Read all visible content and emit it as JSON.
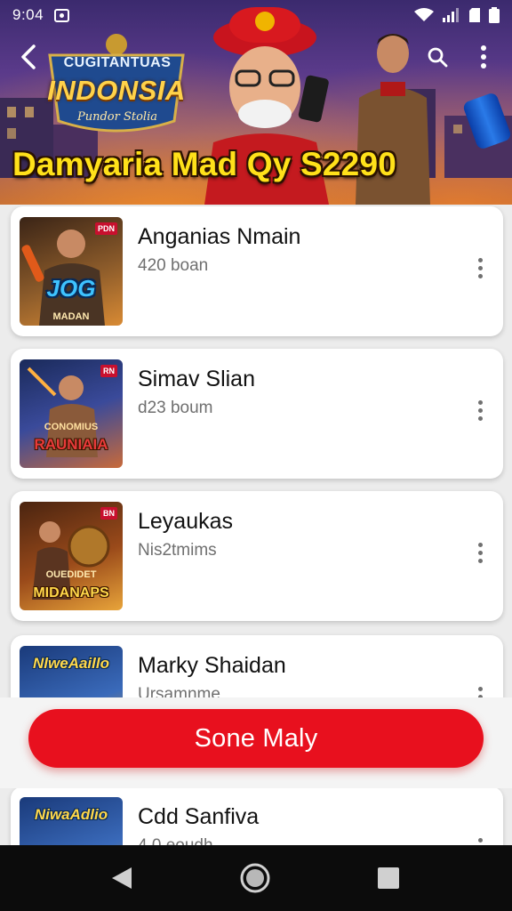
{
  "status_bar": {
    "time": "9:04"
  },
  "banner": {
    "logo_top": "CUGITANTUAS",
    "logo_main": "INDONSIA",
    "logo_sub": "Pundor Stolia",
    "headline": "Damyaria Mad Qy S2290"
  },
  "items": [
    {
      "title": "Anganias Nmain",
      "subtitle": "420 boan",
      "thumb_text": "JOG",
      "thumb_sub": "MADAN",
      "thumb_flag": "PDN",
      "colors": [
        "#3a2416",
        "#8a5a2a",
        "#d88a34"
      ]
    },
    {
      "title": "Simav Slian",
      "subtitle": "d23 boum",
      "thumb_text": "RAUNIAIA",
      "thumb_sub": "CONOMIUS",
      "thumb_flag": "RN",
      "colors": [
        "#1a2a5a",
        "#3a4a9a",
        "#c86a3a"
      ]
    },
    {
      "title": "Leyaukas",
      "subtitle": "Nis2tmims",
      "thumb_text": "MIDANAPS",
      "thumb_sub": "OUEDIDET",
      "thumb_flag": "BN",
      "colors": [
        "#4a2410",
        "#9a4a1a",
        "#e8a43a"
      ]
    },
    {
      "title": "Marky Shaidan",
      "subtitle": "Ursamnme",
      "thumb_text": "NlweAaillo",
      "thumb_sub": "",
      "thumb_flag": "",
      "colors": [
        "#1a3a7a",
        "#3a6aba",
        "#e0a030"
      ]
    },
    {
      "title": "Cdd Sanfiva",
      "subtitle": "4 0 eoudh",
      "thumb_text": "NiwaAdlio",
      "thumb_sub": "",
      "thumb_flag": "",
      "colors": [
        "#1a3a7a",
        "#3a6aba",
        "#e0a030"
      ]
    }
  ],
  "primary_button": {
    "label": "Sone Maly",
    "color": "#e8101e"
  },
  "icons": {
    "back": "arrow-left-icon",
    "search": "search-icon",
    "more": "more-vertical-icon",
    "nav_back": "triangle-back-icon",
    "nav_home": "circle-home-icon",
    "nav_recents": "square-recents-icon"
  }
}
